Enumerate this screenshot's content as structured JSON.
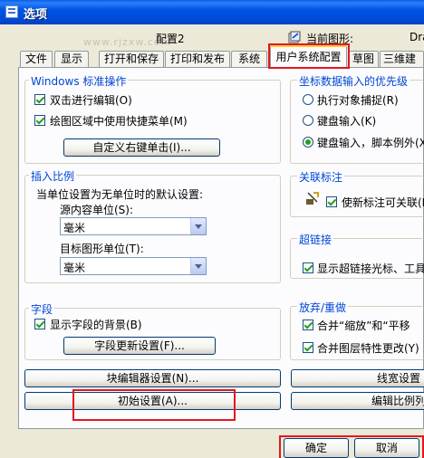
{
  "window": {
    "title": "选项"
  },
  "watermark": "www.rjzxw.com",
  "header": {
    "profile_label": "配置2",
    "current_drawing_label": "当前图形:",
    "current_drawing_value": "Dra"
  },
  "tabs": [
    {
      "label": "文件"
    },
    {
      "label": "显示"
    },
    {
      "label": "打开和保存"
    },
    {
      "label": "打印和发布"
    },
    {
      "label": "系统"
    },
    {
      "label": "用户系统配置",
      "active": true
    },
    {
      "label": "草图"
    },
    {
      "label": "三维建"
    }
  ],
  "windows_std": {
    "title": "Windows 标准操作",
    "double_click_edit": "双击进行编辑(O)",
    "shortcut_menu": "绘图区域中使用快捷菜单(M)",
    "custom_right_click": "自定义右键单击(I)..."
  },
  "insert_scale": {
    "title": "插入比例",
    "desc": "当单位设置为无单位时的默认设置:",
    "source_label": "源内容单位(S):",
    "source_value": "毫米",
    "target_label": "目标图形单位(T):",
    "target_value": "毫米"
  },
  "fields": {
    "title": "字段",
    "show_background": "显示字段的背景(B)",
    "update_settings": "字段更新设置(F)..."
  },
  "coord_priority": {
    "title": "坐标数据输入的优先级",
    "opt1": "执行对象捕捉(R)",
    "opt2": "键盘输入(K)",
    "opt3": "键盘输入，脚本例外(X)"
  },
  "assoc_dim": {
    "title": "关联标注",
    "new_assoc": "使新标注可关联(D)"
  },
  "hyperlink": {
    "title": "超链接",
    "show_cursor": "显示超链接光标、工具"
  },
  "undo_redo": {
    "title": "放弃/重做",
    "combine_zoom_pan": "合并“缩放”和“平移",
    "combine_layer": "合并图层特性更改(Y)"
  },
  "buttons": {
    "block_editor": "块编辑器设置(N)...",
    "initial_setup": "初始设置(A)...",
    "lineweight": "线宽设置",
    "edit_scale_list": "编辑比例列",
    "ok": "确定",
    "cancel": "取消"
  },
  "colors": {
    "titlebar": "#0055e5",
    "group_title": "#0046d5",
    "highlight_box": "#e0191e",
    "panel": "#fcfcfe"
  }
}
